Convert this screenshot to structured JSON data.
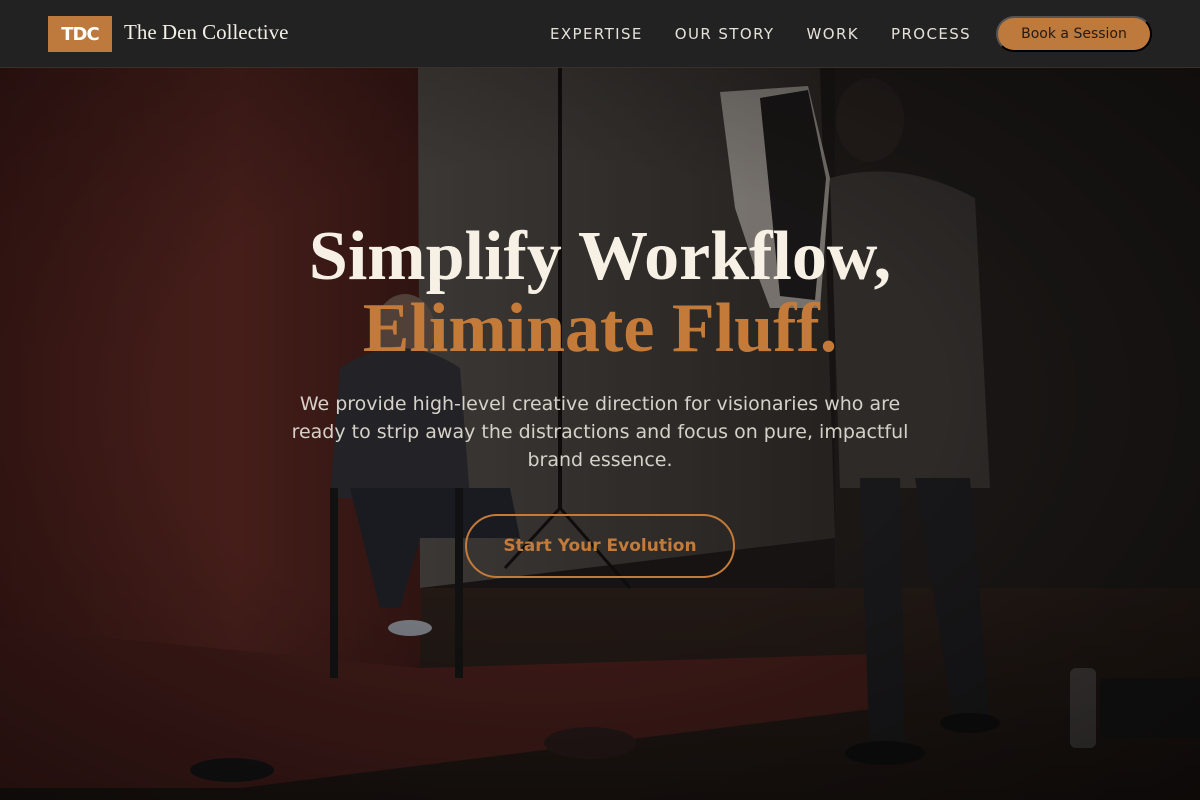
{
  "brand": {
    "logo_text": "TDC",
    "name": "The Den Collective"
  },
  "nav": {
    "links": [
      "EXPERTISE",
      "OUR STORY",
      "WORK",
      "PROCESS"
    ],
    "cta_label": "Book a Session"
  },
  "hero": {
    "headline_line1": "Simplify Workflow,",
    "headline_line2": "Eliminate Fluff.",
    "lead": "We provide high-level creative direction for visionaries who are ready to strip away the distractions and focus on pure, impactful brand essence.",
    "cta_label": "Start Your Evolution"
  },
  "colors": {
    "accent": "#bd7a3c",
    "nav_bg": "#222222",
    "headline": "#f6f1e4",
    "headline_accent": "#c47b3a"
  }
}
